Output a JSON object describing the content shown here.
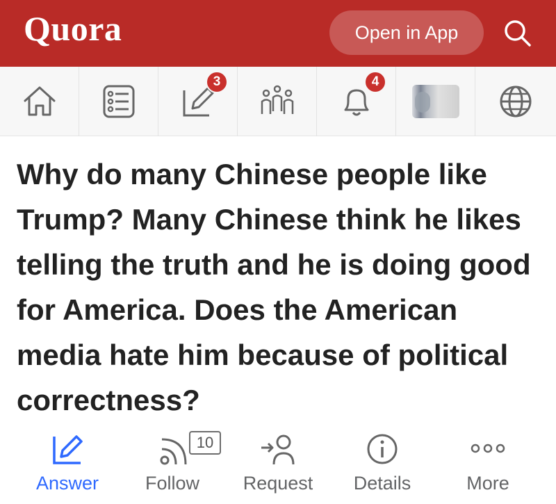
{
  "header": {
    "logo": "Quora",
    "open_app_label": "Open in App",
    "search_icon": "search-icon",
    "background_color": "#b92b27"
  },
  "nav": {
    "items": [
      {
        "icon": "home-icon"
      },
      {
        "icon": "following-feed-icon"
      },
      {
        "icon": "answer-pencil-icon",
        "badge": "3"
      },
      {
        "icon": "spaces-people-icon"
      },
      {
        "icon": "notifications-bell-icon",
        "badge": "4"
      },
      {
        "icon": "profile-avatar"
      },
      {
        "icon": "language-globe-icon"
      }
    ]
  },
  "question": {
    "title": "Why do many Chinese people like Trump? Many Chinese think he likes telling the truth and he is doing good for America. Does the American media hate him because of political correctness?"
  },
  "actions": {
    "answer": {
      "label": "Answer",
      "icon": "answer-pencil-icon",
      "color": "#2e69ff"
    },
    "follow": {
      "label": "Follow",
      "icon": "follow-rss-icon",
      "count": "10"
    },
    "request": {
      "label": "Request",
      "icon": "request-person-icon"
    },
    "details": {
      "label": "Details",
      "icon": "info-icon"
    },
    "more": {
      "label": "More",
      "icon": "more-dots-icon"
    }
  }
}
